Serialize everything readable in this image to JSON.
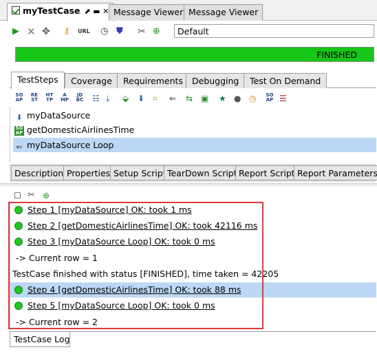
{
  "tabs": [
    {
      "label": "myTestCase",
      "active": true,
      "controls": "⬈ ▬ ✕"
    },
    {
      "label": "Message Viewer",
      "active": false
    },
    {
      "label": "Message Viewer",
      "active": false
    }
  ],
  "runbar": {
    "icons": [
      "run-icon",
      "cancel-icon",
      "loop-icon",
      "key-icon",
      "url-icon",
      "timer-icon",
      "shield-icon",
      "tools-icon",
      "add-icon"
    ],
    "url_text": "URL",
    "environment": "Default"
  },
  "progress": {
    "status": "FINISHED",
    "fraction": 1.0,
    "color": "#17c717"
  },
  "mid_tabs": [
    "TestSteps",
    "Coverage",
    "Requirements",
    "Debugging",
    "Test On Demand"
  ],
  "step_toolbar": {
    "text_icons": [
      "SO AP",
      "RE ST",
      "HT TP",
      "A MP",
      "JD BC"
    ]
  },
  "steps": [
    {
      "label": "myDataSource",
      "icon": "datasource-icon",
      "selected": false
    },
    {
      "label": "getDomesticAirlinesTime",
      "icon": "soap-icon",
      "selected": false
    },
    {
      "label": "myDataSource Loop",
      "icon": "loop-arrow-icon",
      "selected": true
    }
  ],
  "sub_tabs": [
    "Description",
    "Properties",
    "Setup Script",
    "TearDown Script",
    "Report Script",
    "Report Parameters"
  ],
  "log": [
    {
      "text": "Step 1 [myDataSource] OK: took 1 ms",
      "dot": true,
      "link": true,
      "selected": false
    },
    {
      "text": "Step 2 [getDomesticAirlinesTime] OK: took 42116 ms",
      "dot": true,
      "link": true,
      "selected": false
    },
    {
      "text": "Step 3 [myDataSource Loop] OK: took 0 ms",
      "dot": true,
      "link": true,
      "selected": false
    },
    {
      "text": "-> Current row = 1",
      "dot": false,
      "link": false,
      "selected": false
    },
    {
      "text": "TestCase finished with status [FINISHED], time taken = 42205",
      "dot": false,
      "link": false,
      "selected": false
    },
    {
      "text": "Step 4 [getDomesticAirlinesTime] OK: took 88 ms",
      "dot": true,
      "link": true,
      "selected": true
    },
    {
      "text": "Step 5 [myDataSource Loop] OK: took 0 ms",
      "dot": true,
      "link": true,
      "selected": false
    },
    {
      "text": "-> Current row = 2",
      "dot": false,
      "link": false,
      "selected": false
    }
  ],
  "bottom_tab": "TestCase Log",
  "colors": {
    "highlight_box": "#d93a3a",
    "selection": "#bcd8f4",
    "success": "#23c423"
  }
}
